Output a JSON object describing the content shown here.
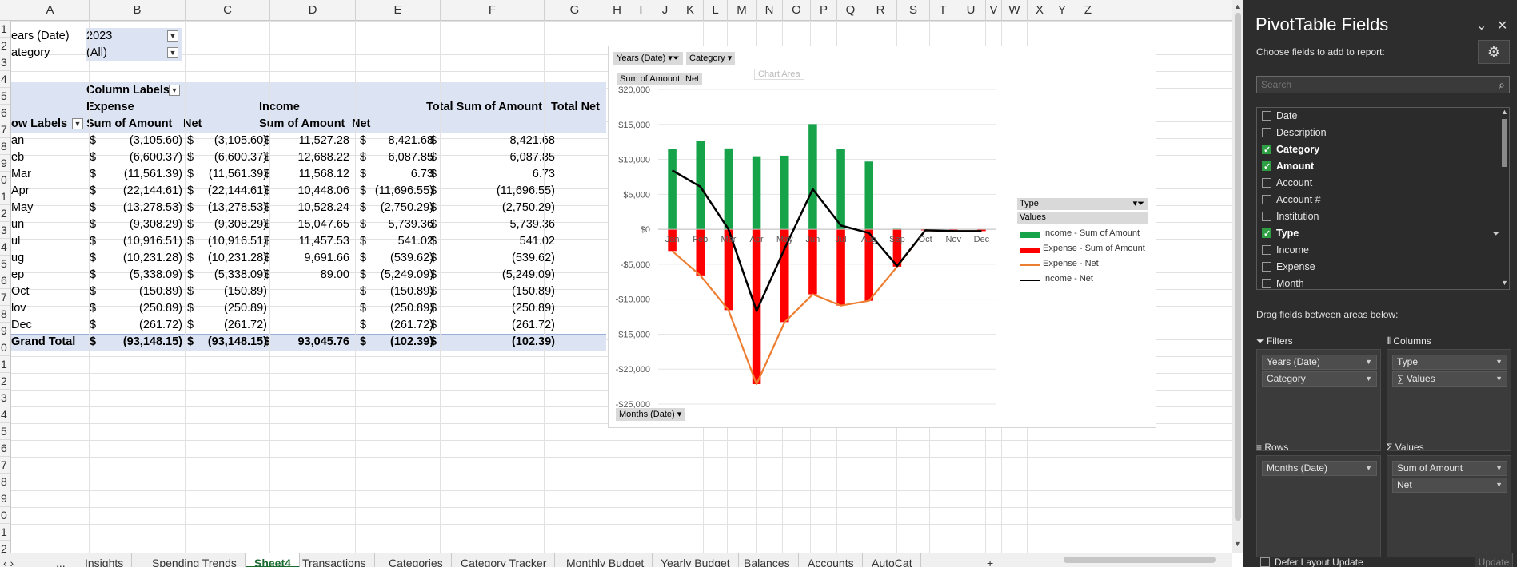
{
  "columns": [
    "A",
    "B",
    "C",
    "D",
    "E",
    "F",
    "G",
    "H",
    "I",
    "J",
    "K",
    "L",
    "M",
    "N",
    "O",
    "P",
    "Q",
    "R",
    "S",
    "T",
    "U",
    "V",
    "W",
    "X",
    "Y",
    "Z"
  ],
  "rows": [
    "1",
    "2",
    "3",
    "4",
    "5",
    "6",
    "7",
    "8",
    "9",
    "0",
    "1",
    "2",
    "3",
    "4",
    "5",
    "6",
    "7",
    "8",
    "9",
    "0",
    "1",
    "2",
    "3",
    "4",
    "5",
    "6",
    "7",
    "8",
    "9",
    "0",
    "1",
    "2"
  ],
  "filters_area": [
    {
      "label": "ears (Date)",
      "value": "2023"
    },
    {
      "label": "ategory",
      "value": "(All)"
    }
  ],
  "pivot": {
    "column_labels": "Column Labels",
    "expense": "Expense",
    "income": "Income",
    "total_sum": "Total Sum of Amount",
    "total_net": "Total Net",
    "row_labels": "ow Labels",
    "sum_of_amount": "Sum of Amount",
    "net": "Net",
    "dollar": "$",
    "rows": [
      {
        "label": "an",
        "exp_sum": "(3,105.60)",
        "exp_net": "(3,105.60)",
        "inc_sum": "11,527.28",
        "inc_net": "8,421.68",
        "total": "8,421.68"
      },
      {
        "label": "eb",
        "exp_sum": "(6,600.37)",
        "exp_net": "(6,600.37)",
        "inc_sum": "12,688.22",
        "inc_net": "6,087.85",
        "total": "6,087.85"
      },
      {
        "label": "Mar",
        "exp_sum": "(11,561.39)",
        "exp_net": "(11,561.39)",
        "inc_sum": "11,568.12",
        "inc_net": "6.73",
        "total": "6.73"
      },
      {
        "label": "Apr",
        "exp_sum": "(22,144.61)",
        "exp_net": "(22,144.61)",
        "inc_sum": "10,448.06",
        "inc_net": "(11,696.55)",
        "total": "(11,696.55)"
      },
      {
        "label": "May",
        "exp_sum": "(13,278.53)",
        "exp_net": "(13,278.53)",
        "inc_sum": "10,528.24",
        "inc_net": "(2,750.29)",
        "total": "(2,750.29)"
      },
      {
        "label": "un",
        "exp_sum": "(9,308.29)",
        "exp_net": "(9,308.29)",
        "inc_sum": "15,047.65",
        "inc_net": "5,739.36",
        "total": "5,739.36"
      },
      {
        "label": "ul",
        "exp_sum": "(10,916.51)",
        "exp_net": "(10,916.51)",
        "inc_sum": "11,457.53",
        "inc_net": "541.02",
        "total": "541.02"
      },
      {
        "label": "ug",
        "exp_sum": "(10,231.28)",
        "exp_net": "(10,231.28)",
        "inc_sum": "9,691.66",
        "inc_net": "(539.62)",
        "total": "(539.62)"
      },
      {
        "label": "ep",
        "exp_sum": "(5,338.09)",
        "exp_net": "(5,338.09)",
        "inc_sum": "89.00",
        "inc_net": "(5,249.09)",
        "total": "(5,249.09)"
      },
      {
        "label": "Oct",
        "exp_sum": "(150.89)",
        "exp_net": "(150.89)",
        "inc_sum": "",
        "inc_net": "(150.89)",
        "total": "(150.89)"
      },
      {
        "label": "lov",
        "exp_sum": "(250.89)",
        "exp_net": "(250.89)",
        "inc_sum": "",
        "inc_net": "(250.89)",
        "total": "(250.89)"
      },
      {
        "label": "Dec",
        "exp_sum": "(261.72)",
        "exp_net": "(261.72)",
        "inc_sum": "",
        "inc_net": "(261.72)",
        "total": "(261.72)"
      }
    ],
    "grand": {
      "label": "Grand Total",
      "exp_sum": "(93,148.15)",
      "exp_net": "(93,148.15)",
      "inc_sum": "93,045.76",
      "inc_net": "(102.39)",
      "total": "(102.39)"
    }
  },
  "chart_buttons": {
    "years": "Years (Date)",
    "category": "Category",
    "sum_amount": "Sum of Amount",
    "net": "Net",
    "months": "Months (Date)",
    "chart_area": "Chart Area"
  },
  "legend": {
    "type": "Type",
    "values": "Values"
  },
  "chart_data": {
    "type": "bar",
    "categories": [
      "Jan",
      "Feb",
      "Mar",
      "Apr",
      "May",
      "Jun",
      "Jul",
      "Aug",
      "Sep",
      "Oct",
      "Nov",
      "Dec"
    ],
    "category_labels": [
      "Jan",
      "Feb",
      "Mar",
      "Apr",
      "May",
      "Jun",
      "Jul",
      "Aug",
      "Sep",
      "Oct",
      "Nov",
      "Dec"
    ],
    "ylim": [
      -25000,
      20000
    ],
    "yticks": [
      "$20,000",
      "$15,000",
      "$10,000",
      "$5,000",
      "$0",
      "-$5,000",
      "-$10,000",
      "-$15,000",
      "-$20,000",
      "-$25,000"
    ],
    "grid": true,
    "legend_position": "right",
    "series": [
      {
        "name": "Income - Sum of Amount",
        "kind": "bar",
        "color": "#16a34a",
        "values": [
          11527.28,
          12688.22,
          11568.12,
          10448.06,
          10528.24,
          15047.65,
          11457.53,
          9691.66,
          89.0,
          0,
          0,
          0
        ]
      },
      {
        "name": "Expense - Sum of Amount",
        "kind": "bar",
        "color": "#ff0000",
        "values": [
          -3105.6,
          -6600.37,
          -11561.39,
          -22144.61,
          -13278.53,
          -9308.29,
          -10916.51,
          -10231.28,
          -5338.09,
          -150.89,
          -250.89,
          -261.72
        ]
      },
      {
        "name": "Expense - Net",
        "kind": "line",
        "color": "#ed7d31",
        "values": [
          -3105.6,
          -6600.37,
          -11561.39,
          -22144.61,
          -13278.53,
          -9308.29,
          -10916.51,
          -10231.28,
          -5338.09,
          -150.89,
          -250.89,
          -261.72
        ]
      },
      {
        "name": "Income - Net",
        "kind": "line",
        "color": "#000000",
        "values": [
          8421.68,
          6087.85,
          6.73,
          -11696.55,
          -2750.29,
          5739.36,
          541.02,
          -539.62,
          -5249.09,
          -150.89,
          -250.89,
          -261.72
        ]
      }
    ]
  },
  "tabs": [
    "...",
    "Insights",
    "Spending Trends",
    "Sheet4",
    "Transactions",
    "Categories",
    "Category Tracker",
    "Monthly Budget",
    "Yearly Budget",
    "Balances",
    "Accounts",
    "AutoCat"
  ],
  "active_tab": "Sheet4",
  "pane": {
    "title": "PivotTable Fields",
    "subtitle": "Choose fields to add to report:",
    "search_placeholder": "Search",
    "fields": [
      {
        "name": "Date",
        "checked": false
      },
      {
        "name": "Description",
        "checked": false
      },
      {
        "name": "Category",
        "checked": true
      },
      {
        "name": "Amount",
        "checked": true
      },
      {
        "name": "Account",
        "checked": false
      },
      {
        "name": "Account #",
        "checked": false
      },
      {
        "name": "Institution",
        "checked": false
      },
      {
        "name": "Type",
        "checked": true
      },
      {
        "name": "Income",
        "checked": false
      },
      {
        "name": "Expense",
        "checked": false
      },
      {
        "name": "Month",
        "checked": false
      }
    ],
    "drag_label": "Drag fields between areas below:",
    "filters_title": "Filters",
    "columns_title": "Columns",
    "rows_title": "Rows",
    "values_title": "Values",
    "filters_items": [
      "Years (Date)",
      "Category"
    ],
    "columns_items": [
      "Type",
      "∑ Values"
    ],
    "rows_items": [
      "Months (Date)"
    ],
    "values_items": [
      "Sum of Amount",
      "Net"
    ],
    "defer": "Defer Layout Update",
    "update": "Update"
  }
}
